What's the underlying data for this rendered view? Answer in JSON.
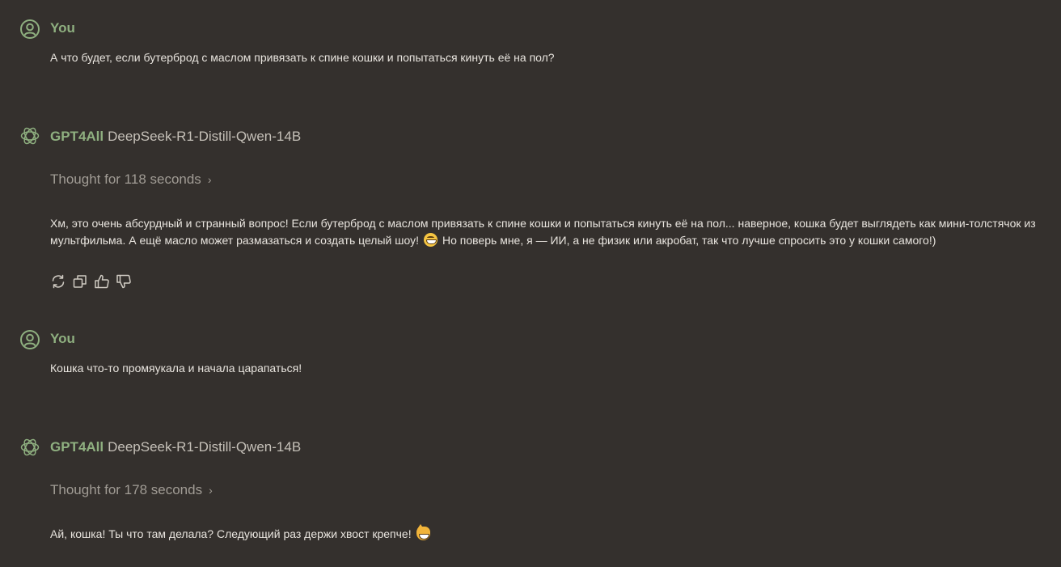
{
  "colors": {
    "background": "#34302d",
    "accent_green": "#8fb080",
    "text": "#e8e4de",
    "muted": "#a19c95"
  },
  "messages": [
    {
      "role": "user",
      "sender": "You",
      "avatar_icon": "user-circle-icon",
      "text": "А что будет, если бутерброд с маслом привязать к спине кошки и попытаться кинуть её на пол?"
    },
    {
      "role": "assistant",
      "sender": "GPT4All",
      "model": "DeepSeek-R1-Distill-Qwen-14B",
      "avatar_icon": "gpt4all-logo-icon",
      "thought": "Thought for 118 seconds",
      "text_part1": "Хм, это очень абсурдный и странный вопрос! Если бутерброд с маслом привязать к спине кошки и попытаться кинуть её на пол... наверное, кошка будет выглядеть как мини-толстячок из мультфильма. А ещё масло может размазаться и создать целый шоу!",
      "emoji": "grinning-face-emoji",
      "text_part2": "Но поверь мне, я — ИИ, а не физик или акробат, так что лучше спросить это у кошки самого!)",
      "actions": [
        {
          "name": "regenerate-icon",
          "title": "regenerate"
        },
        {
          "name": "copy-icon",
          "title": "copy"
        },
        {
          "name": "thumbs-up-icon",
          "title": "like"
        },
        {
          "name": "thumbs-down-icon",
          "title": "dislike"
        }
      ]
    },
    {
      "role": "user",
      "sender": "You",
      "avatar_icon": "user-circle-icon",
      "text": "Кошка что-то промяукала и начала царапаться!"
    },
    {
      "role": "assistant",
      "sender": "GPT4All",
      "model": "DeepSeek-R1-Distill-Qwen-14B",
      "avatar_icon": "gpt4all-logo-icon",
      "thought": "Thought for 178 seconds",
      "text": "Ай, кошка! Ты что там делала? Следующий раз держи хвост крепче!",
      "emoji": "grinning-cat-emoji"
    }
  ]
}
